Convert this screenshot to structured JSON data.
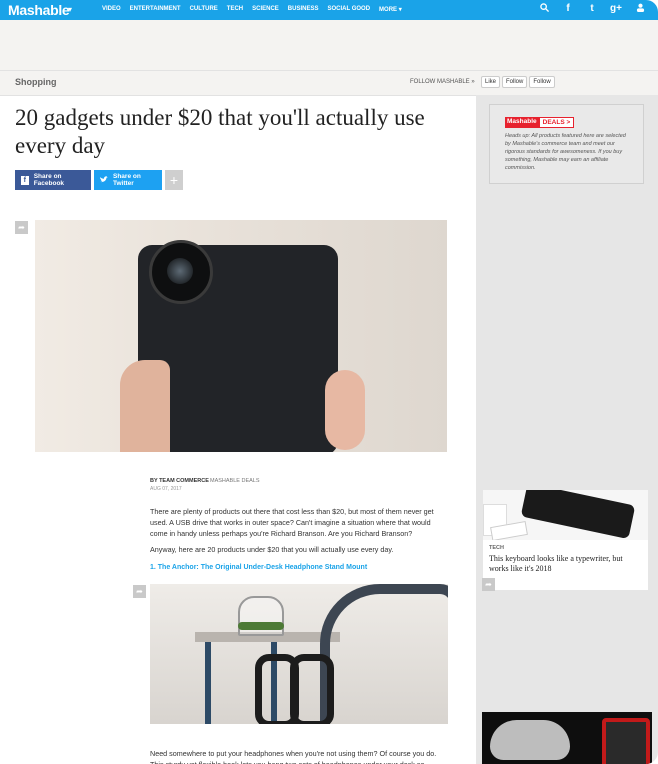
{
  "nav": {
    "logo": "Mashable",
    "caret": "▾",
    "items": [
      "VIDEO",
      "ENTERTAINMENT",
      "CULTURE",
      "TECH",
      "SCIENCE",
      "BUSINESS",
      "SOCIAL GOOD",
      "MORE ▾"
    ],
    "icons": [
      "search-icon",
      "facebook-icon",
      "twitter-icon",
      "google-plus-icon",
      "user-icon"
    ]
  },
  "section": {
    "title": "Shopping",
    "follow": "FOLLOW MASHABLE »",
    "like": "Like",
    "twitter_follow": "Follow",
    "gplus_follow": "Follow"
  },
  "article": {
    "title": "20 gadgets under $20 that you'll actually use every day",
    "share_facebook": "Share on Facebook",
    "share_twitter": "Share on Twitter",
    "share_more": "+",
    "byline": "BY TEAM COMMERCE",
    "category": "MASHABLE DEALS",
    "date": "AUG 07, 2017",
    "para1": "There are plenty of products out there that cost less than $20, but most of them never get used. A USB drive that works in outer space? Can't imagine a situation where that would come in handy unless perhaps you're Richard Branson. Are you Richard Branson?",
    "para2": "Anyway, here are 20 products under $20 that you will actually use every day.",
    "item1": "1. The Anchor: The Original Under-Desk Headphone Stand Mount",
    "para3": "Need somewhere to put your headphones when you're not using them? Of course you do. This sturdy yet flexible hook lets you hang two sets of headphones under your desk so"
  },
  "sidebar": {
    "deals_logo_a": "Mashable",
    "deals_logo_b": "DEALS >",
    "deals_text": "Heads up: All products featured here are selected by Mashable's commerce team and meet our rigorous standards for awesomeness. If you buy something, Mashable may earn an affiliate commission.",
    "card_category": "TECH",
    "card_title": "This keyboard looks like a typewriter, but works like it's 2018"
  }
}
